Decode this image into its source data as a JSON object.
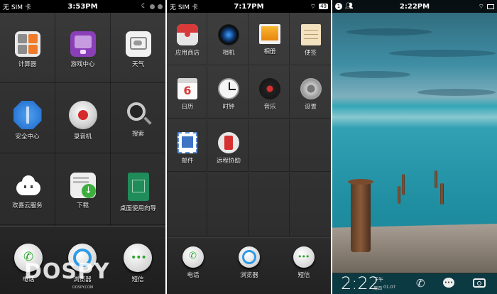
{
  "screen1": {
    "status": {
      "carrier": "无 SIM 卡",
      "time": "3:53PM"
    },
    "apps": [
      {
        "label": "计算器",
        "icon": "calculator-icon"
      },
      {
        "label": "游戏中心",
        "icon": "game-center-icon"
      },
      {
        "label": "天气",
        "icon": "weather-icon"
      },
      {
        "label": "安全中心",
        "icon": "security-center-icon"
      },
      {
        "label": "录音机",
        "icon": "recorder-icon"
      },
      {
        "label": "搜索",
        "icon": "search-icon"
      },
      {
        "label": "欢喜云服务",
        "icon": "cloud-service-icon"
      },
      {
        "label": "下载",
        "icon": "download-icon"
      },
      {
        "label": "桌面使用向导",
        "icon": "desktop-guide-icon"
      }
    ],
    "dock": [
      {
        "label": "电话",
        "icon": "phone-icon"
      },
      {
        "label": "浏览器",
        "icon": "browser-icon"
      },
      {
        "label": "短信",
        "icon": "sms-icon"
      }
    ],
    "watermark": "DOSPY",
    "watermark_sub": "DOSPY.COM"
  },
  "screen2": {
    "status": {
      "carrier": "无 SIM 卡",
      "time": "7:17PM",
      "battery": "49"
    },
    "apps": [
      {
        "label": "应用商店",
        "icon": "app-store-icon"
      },
      {
        "label": "相机",
        "icon": "camera-icon"
      },
      {
        "label": "相册",
        "icon": "gallery-icon"
      },
      {
        "label": "便签",
        "icon": "notes-icon"
      },
      {
        "label": "日历",
        "icon": "calendar-icon",
        "day": "6"
      },
      {
        "label": "时钟",
        "icon": "clock-icon"
      },
      {
        "label": "音乐",
        "icon": "music-icon"
      },
      {
        "label": "设置",
        "icon": "settings-icon"
      },
      {
        "label": "邮件",
        "icon": "mail-icon"
      },
      {
        "label": "远程协助",
        "icon": "remote-assist-icon"
      }
    ],
    "dock": [
      {
        "label": "电话",
        "icon": "phone-icon"
      },
      {
        "label": "浏览器",
        "icon": "browser-icon"
      },
      {
        "label": "短信",
        "icon": "sms-icon"
      }
    ]
  },
  "screen3": {
    "status": {
      "time": "2:22PM",
      "notif_count": "1"
    },
    "lock": {
      "time": "2:22",
      "ampm": "下午",
      "weekday": "周四",
      "date": "01.07"
    }
  }
}
